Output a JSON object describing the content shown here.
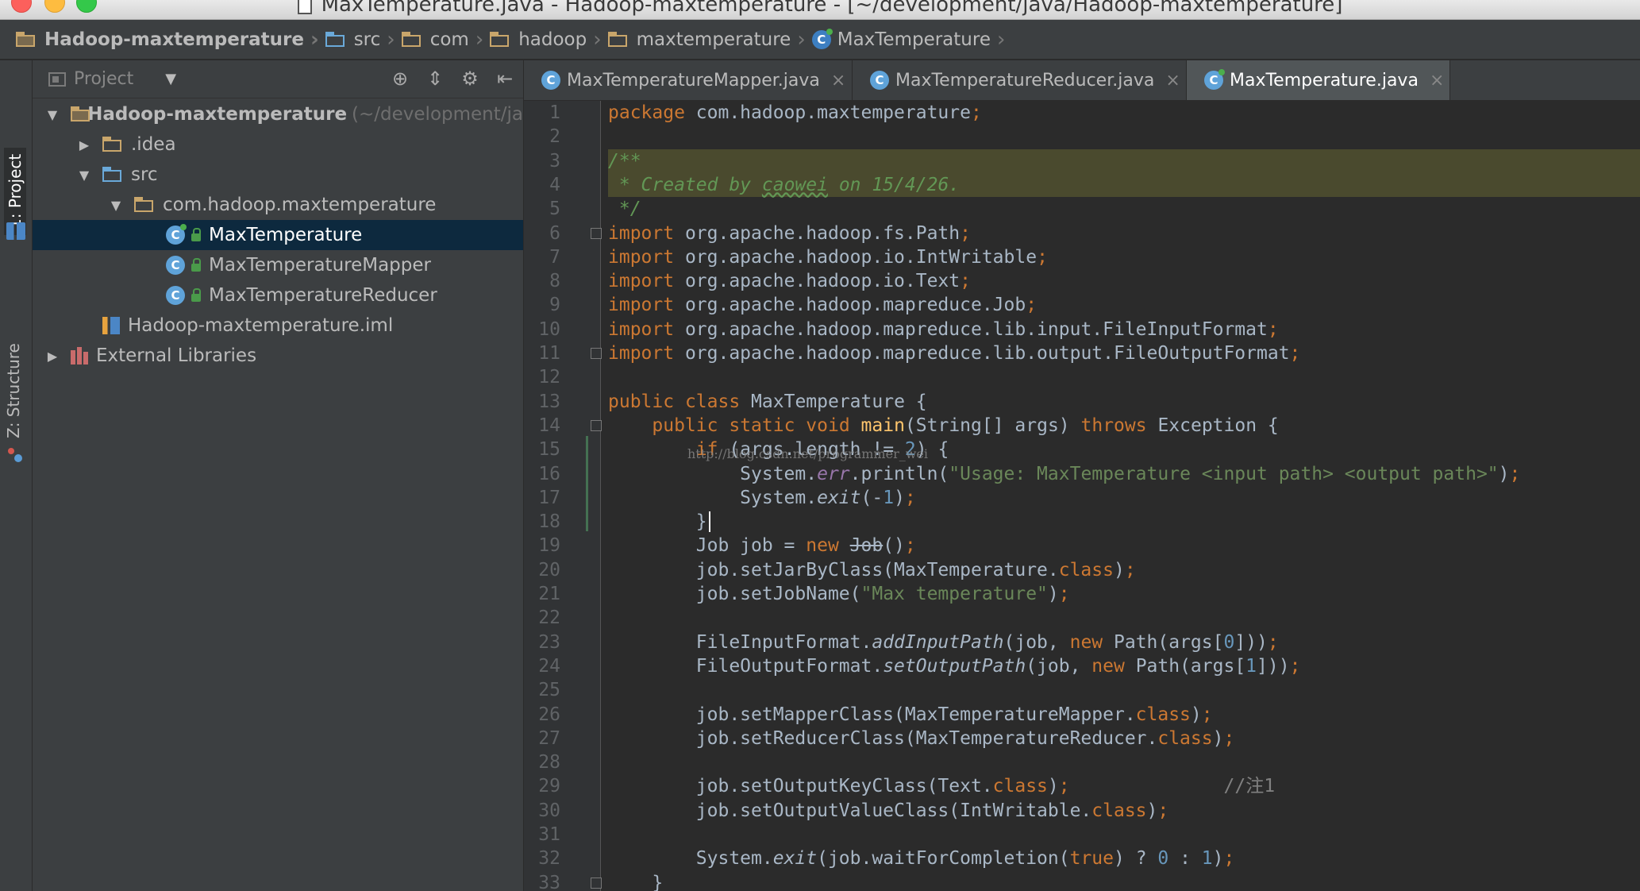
{
  "window": {
    "title": "MaxTemperature.java - Hadoop-maxtemperature - [~/development/java/Hadoop-maxtemperature]"
  },
  "breadcrumb": [
    {
      "label": "Hadoop-maxtemperature",
      "icon": "project-folder-icon"
    },
    {
      "label": "src",
      "icon": "source-folder-icon"
    },
    {
      "label": "com",
      "icon": "package-folder-icon"
    },
    {
      "label": "hadoop",
      "icon": "package-folder-icon"
    },
    {
      "label": "maxtemperature",
      "icon": "package-folder-icon"
    },
    {
      "label": "MaxTemperature",
      "icon": "class-icon"
    }
  ],
  "toolstrip": {
    "project_tab": "1: Project",
    "structure_tab": "Z: Structure"
  },
  "project_panel": {
    "header_label": "Project",
    "tree": [
      {
        "label": "Hadoop-maxtemperature",
        "hint": "(~/development/ja",
        "depth": 0,
        "arrow": "expanded",
        "icon": "project-folder-icon"
      },
      {
        "label": ".idea",
        "depth": 1,
        "arrow": "collapsed",
        "icon": "folder-icon"
      },
      {
        "label": "src",
        "depth": 1,
        "arrow": "expanded",
        "icon": "source-folder-icon"
      },
      {
        "label": "com.hadoop.maxtemperature",
        "depth": 2,
        "arrow": "expanded",
        "icon": "package-folder-icon"
      },
      {
        "label": "MaxTemperature",
        "depth": 3,
        "icon": "main-class-icon",
        "selected": true
      },
      {
        "label": "MaxTemperatureMapper",
        "depth": 3,
        "icon": "class-icon"
      },
      {
        "label": "MaxTemperatureReducer",
        "depth": 3,
        "icon": "class-icon"
      },
      {
        "label": "Hadoop-maxtemperature.iml",
        "depth": 2,
        "icon": "iml-file-icon"
      },
      {
        "label": "External Libraries",
        "depth": 0,
        "arrow": "collapsed",
        "icon": "libraries-icon"
      }
    ]
  },
  "editor_tabs": [
    {
      "label": "MaxTemperatureMapper.java",
      "active": false
    },
    {
      "label": "MaxTemperatureReducer.java",
      "active": false
    },
    {
      "label": "MaxTemperature.java",
      "active": true
    }
  ],
  "editor": {
    "watermark": "http://blog.csdn.net/programmer_wei",
    "lines": [
      "package com.hadoop.maxtemperature;",
      "",
      "/**",
      " * Created by caowei on 15/4/26.",
      " */",
      "import org.apache.hadoop.fs.Path;",
      "import org.apache.hadoop.io.IntWritable;",
      "import org.apache.hadoop.io.Text;",
      "import org.apache.hadoop.mapreduce.Job;",
      "import org.apache.hadoop.mapreduce.lib.input.FileInputFormat;",
      "import org.apache.hadoop.mapreduce.lib.output.FileOutputFormat;",
      "",
      "public class MaxTemperature {",
      "    public static void main(String[] args) throws Exception {",
      "        if (args.length != 2) {",
      "            System.err.println(\"Usage: MaxTemperature <input path> <output path>\");",
      "            System.exit(-1);",
      "        }",
      "        Job job = new Job();",
      "        job.setJarByClass(MaxTemperature.class);",
      "        job.setJobName(\"Max temperature\");",
      "",
      "        FileInputFormat.addInputPath(job, new Path(args[0]));",
      "        FileOutputFormat.setOutputPath(job, new Path(args[1]));",
      "",
      "        job.setMapperClass(MaxTemperatureMapper.class);",
      "        job.setReducerClass(MaxTemperatureReducer.class);",
      "",
      "        job.setOutputKeyClass(Text.class);              //注1",
      "        job.setOutputValueClass(IntWritable.class);",
      "",
      "        System.exit(job.waitForCompletion(true) ? 0 : 1);",
      "    }"
    ]
  },
  "colors": {
    "keyword": "#cc7832",
    "string": "#6a8759",
    "number": "#6897bb",
    "comment": "#629755",
    "text": "#a9b7c6",
    "selection": "#0d293e"
  }
}
